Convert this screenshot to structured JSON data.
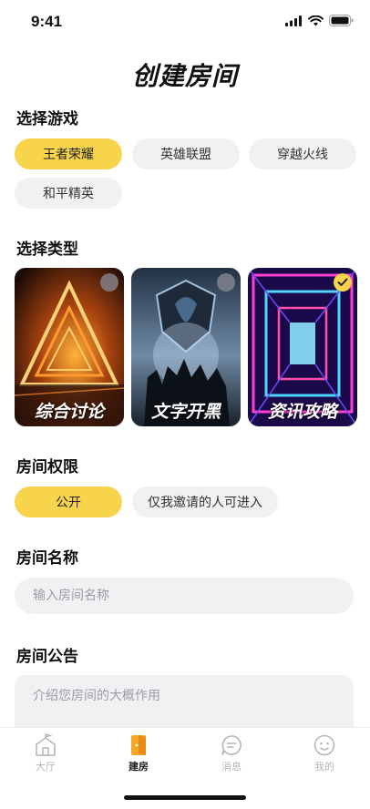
{
  "status_bar": {
    "time": "9:41"
  },
  "page_title": "创建房间",
  "sections": {
    "game": "选择游戏",
    "type": "选择类型",
    "permission": "房间权限",
    "name": "房间名称",
    "notice": "房间公告"
  },
  "games": [
    "王者荣耀",
    "英雄联盟",
    "穿越火线",
    "和平精英"
  ],
  "selected_game": "王者荣耀",
  "room_types": [
    {
      "label": "综合讨论",
      "selected": false
    },
    {
      "label": "文字开黑",
      "selected": false
    },
    {
      "label": "资讯攻略",
      "selected": true
    }
  ],
  "permissions": [
    "公开",
    "仅我邀请的人可进入"
  ],
  "selected_permission": "公开",
  "room_name_input": {
    "placeholder": "输入房间名称",
    "value": ""
  },
  "room_notice_input": {
    "placeholder": "介绍您房间的大概作用",
    "value": ""
  },
  "tab_bar": {
    "items": [
      {
        "label": "大厅",
        "icon": "hall-icon",
        "active": false
      },
      {
        "label": "建房",
        "icon": "create-room-icon",
        "active": true
      },
      {
        "label": "消息",
        "icon": "message-icon",
        "active": false
      },
      {
        "label": "我的",
        "icon": "profile-icon",
        "active": false
      }
    ]
  },
  "colors": {
    "accent": "#f8d44c",
    "chip_bg": "#f1f1f3",
    "active_tab_icon": "#f5a623",
    "inactive": "#b5b5bb"
  }
}
